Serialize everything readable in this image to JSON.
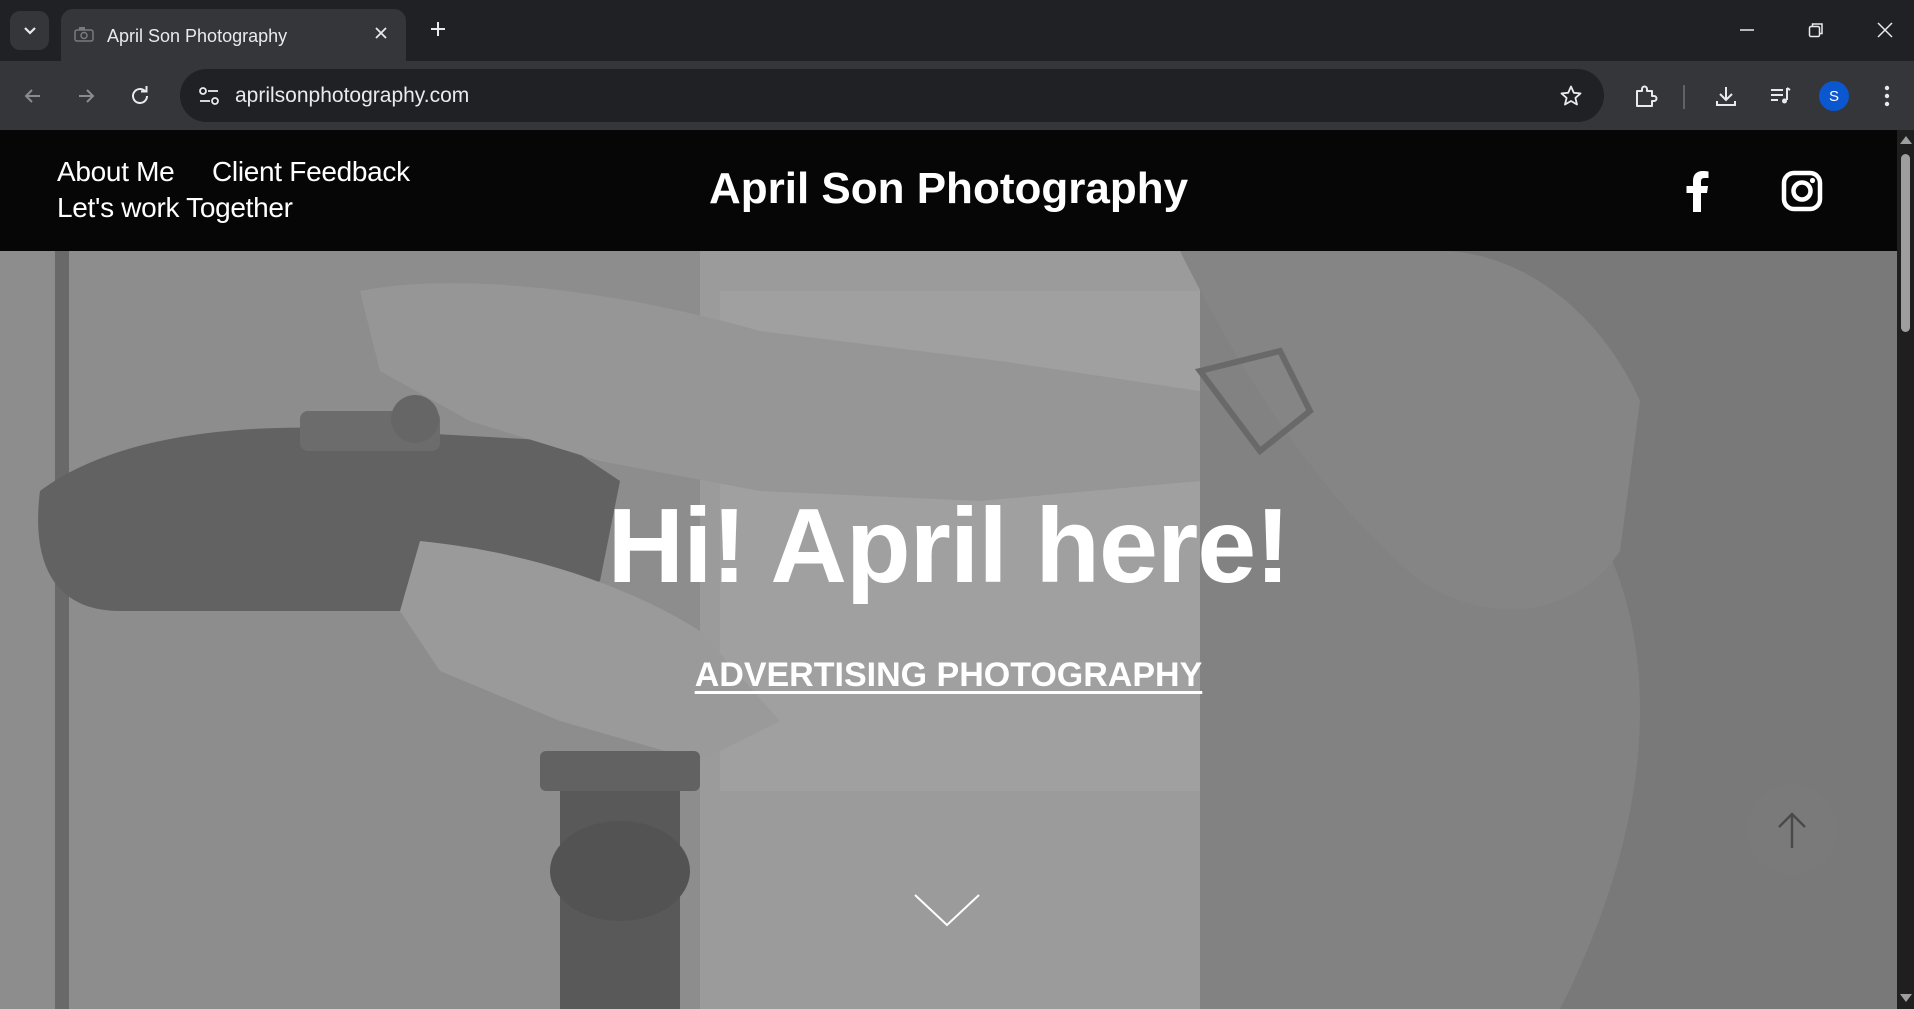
{
  "browser": {
    "tab_title": "April Son Photography",
    "url": "aprilsonphotography.com",
    "profile_initial": "S",
    "icons": [
      "tab-search-icon",
      "tab-favicon-icon",
      "close-icon",
      "plus-icon",
      "minimize-icon",
      "restore-icon",
      "window-close-icon",
      "back-icon",
      "forward-icon",
      "reload-icon",
      "site-info-icon",
      "star-icon",
      "extensions-icon",
      "download-icon",
      "media-icon",
      "menu-icon"
    ]
  },
  "site": {
    "nav": {
      "about": "About Me",
      "feedback": "Client Feedback",
      "work": "Let's work Together"
    },
    "brand": "April Son Photography",
    "social": [
      "facebook-icon",
      "instagram-icon"
    ]
  },
  "hero": {
    "title": "Hi! April here!",
    "link": "ADVERTISING PHOTOGRAPHY",
    "icons": [
      "chevron-down-icon",
      "arrow-up-icon"
    ]
  },
  "colors": {
    "chrome_dark": "#202124",
    "chrome_toolbar": "#35363a",
    "header_bg": "#060606",
    "hero_overlay": "#8f8f8f",
    "text": "#ffffff",
    "avatar": "#0b57d0"
  }
}
